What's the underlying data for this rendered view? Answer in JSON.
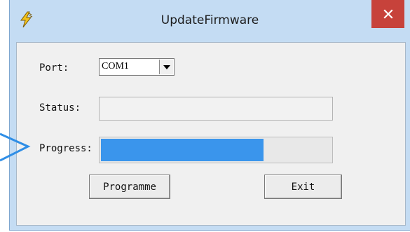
{
  "window": {
    "title": "UpdateFirmware",
    "icon": "lightning-app-icon",
    "close_icon": "close-icon"
  },
  "form": {
    "port": {
      "label": "Port:",
      "selected": "COM1",
      "dropdown_icon": "triangle-down-icon"
    },
    "status": {
      "label": "Status:",
      "value": ""
    },
    "progress": {
      "label": "Progress:",
      "percent": 71
    }
  },
  "buttons": {
    "programme": "Programme",
    "exit": "Exit"
  },
  "colors": {
    "titlebar": "#c4dcf3",
    "close_button": "#c7423b",
    "progress_fill": "#3a95ec",
    "callout": "#2f8ee6"
  }
}
